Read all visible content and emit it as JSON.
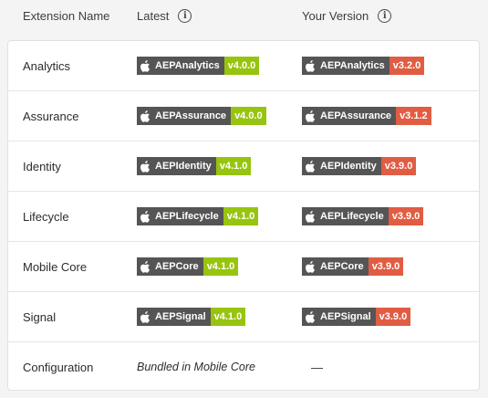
{
  "header": {
    "col_name": "Extension Name",
    "col_latest": "Latest",
    "col_yours": "Your Version",
    "info_icon": "info-icon"
  },
  "colors": {
    "latest_badge": "#97c40f",
    "outdated_badge": "#e05d44",
    "label_bg": "#555555"
  },
  "rows": [
    {
      "name": "Analytics",
      "latest": {
        "label": "AEPAnalytics",
        "version": "v4.0.0"
      },
      "yours": {
        "label": "AEPAnalytics",
        "version": "v3.2.0"
      }
    },
    {
      "name": "Assurance",
      "latest": {
        "label": "AEPAssurance",
        "version": "v4.0.0"
      },
      "yours": {
        "label": "AEPAssurance",
        "version": "v3.1.2"
      }
    },
    {
      "name": "Identity",
      "latest": {
        "label": "AEPIdentity",
        "version": "v4.1.0"
      },
      "yours": {
        "label": "AEPIdentity",
        "version": "v3.9.0"
      }
    },
    {
      "name": "Lifecycle",
      "latest": {
        "label": "AEPLifecycle",
        "version": "v4.1.0"
      },
      "yours": {
        "label": "AEPLifecycle",
        "version": "v3.9.0"
      }
    },
    {
      "name": "Mobile Core",
      "latest": {
        "label": "AEPCore",
        "version": "v4.1.0"
      },
      "yours": {
        "label": "AEPCore",
        "version": "v3.9.0"
      }
    },
    {
      "name": "Signal",
      "latest": {
        "label": "AEPSignal",
        "version": "v4.1.0"
      },
      "yours": {
        "label": "AEPSignal",
        "version": "v3.9.0"
      }
    },
    {
      "name": "Configuration",
      "latest_note": "Bundled in Mobile Core",
      "yours_note": "—"
    }
  ]
}
